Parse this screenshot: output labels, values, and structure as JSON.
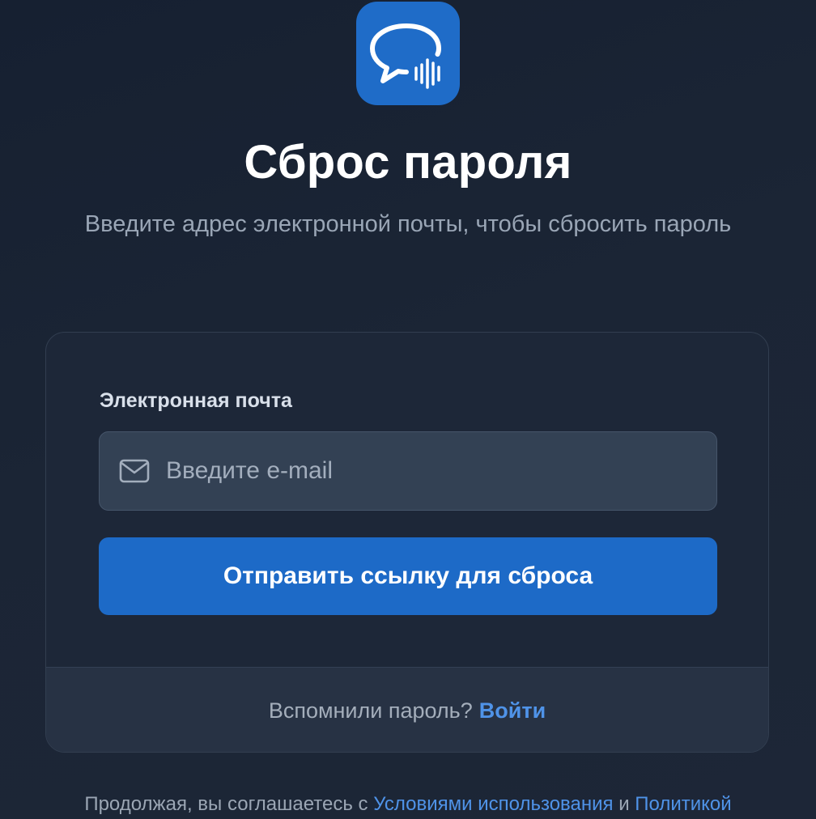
{
  "app": {
    "logo_icon": "chat-bubble-voice-icon",
    "accent_color": "#1f6cc8"
  },
  "header": {
    "title": "Сброс пароля",
    "subtitle": "Введите адрес электронной почты, чтобы сбросить пароль"
  },
  "form": {
    "email_label": "Электронная почта",
    "email_icon": "mail-icon",
    "email_placeholder": "Введите e-mail",
    "email_value": "",
    "submit_label": "Отправить ссылку для сброса"
  },
  "footer": {
    "prompt": "Вспомнили пароль?",
    "login_link": "Войти"
  },
  "legal": {
    "prefix": "Продолжая, вы соглашаетесь с",
    "terms_link": "Условиями использования",
    "conjunction": "и",
    "privacy_link": "Политикой"
  }
}
